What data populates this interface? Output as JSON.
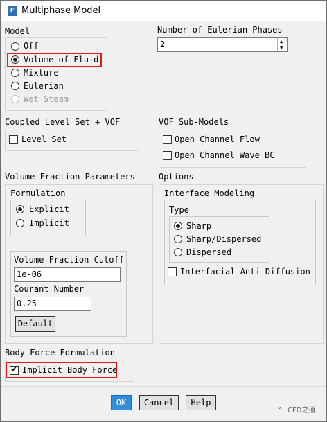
{
  "window": {
    "title": "Multiphase Model",
    "app_icon": "F"
  },
  "model": {
    "heading": "Model",
    "options": [
      "Off",
      "Volume of Fluid",
      "Mixture",
      "Eulerian",
      "Wet Steam"
    ],
    "selected": "Volume of Fluid",
    "disabled": [
      "Wet Steam"
    ]
  },
  "phases": {
    "label": "Number of Eulerian Phases",
    "value": "2"
  },
  "coupled": {
    "heading": "Coupled Level Set + VOF",
    "level_set_label": "Level Set",
    "level_set_checked": false
  },
  "vof_sub": {
    "heading": "VOF Sub-Models",
    "open_channel_flow": "Open Channel Flow",
    "open_channel_wave_bc": "Open Channel Wave BC"
  },
  "vfp": {
    "heading": "Volume Fraction Parameters",
    "formulation_label": "Formulation",
    "explicit": "Explicit",
    "implicit": "Implicit",
    "selected": "Explicit",
    "cutoff_label": "Volume Fraction Cutoff",
    "cutoff_value": "1e-06",
    "courant_label": "Courant Number",
    "courant_value": "0.25",
    "default_button": "Default"
  },
  "options": {
    "heading": "Options",
    "interface_label": "Interface Modeling",
    "type_label": "Type",
    "sharp": "Sharp",
    "sharp_dispersed": "Sharp/Dispersed",
    "dispersed": "Dispersed",
    "selected": "Sharp",
    "anti_diffusion": "Interfacial Anti-Diffusion"
  },
  "body_force": {
    "heading": "Body Force Formulation",
    "implicit_label": "Implicit Body Force",
    "implicit_checked": true
  },
  "buttons": {
    "ok": "OK",
    "cancel": "Cancel",
    "help": "Help"
  },
  "watermark": "CFD之道",
  "colors": {
    "highlight": "#e11b1b",
    "ok_button": "#2f8edc",
    "dialog_bg": "#f0f0f0"
  }
}
